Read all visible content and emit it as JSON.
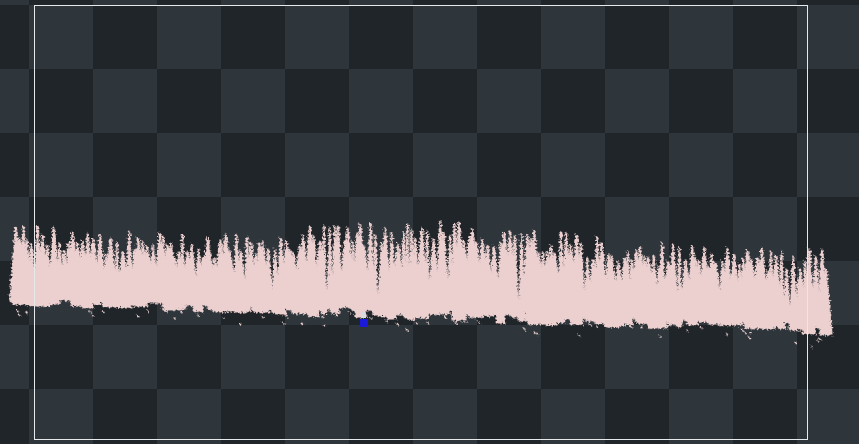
{
  "viewport": {
    "background_dark": "#1f2529",
    "background_light": "#2e363c",
    "frame_color": "#e6e9ec",
    "point_color": "#ecd0d0",
    "marker_color": "#1a1ad8"
  },
  "icons": {
    "origin_marker": "position-marker-icon"
  }
}
